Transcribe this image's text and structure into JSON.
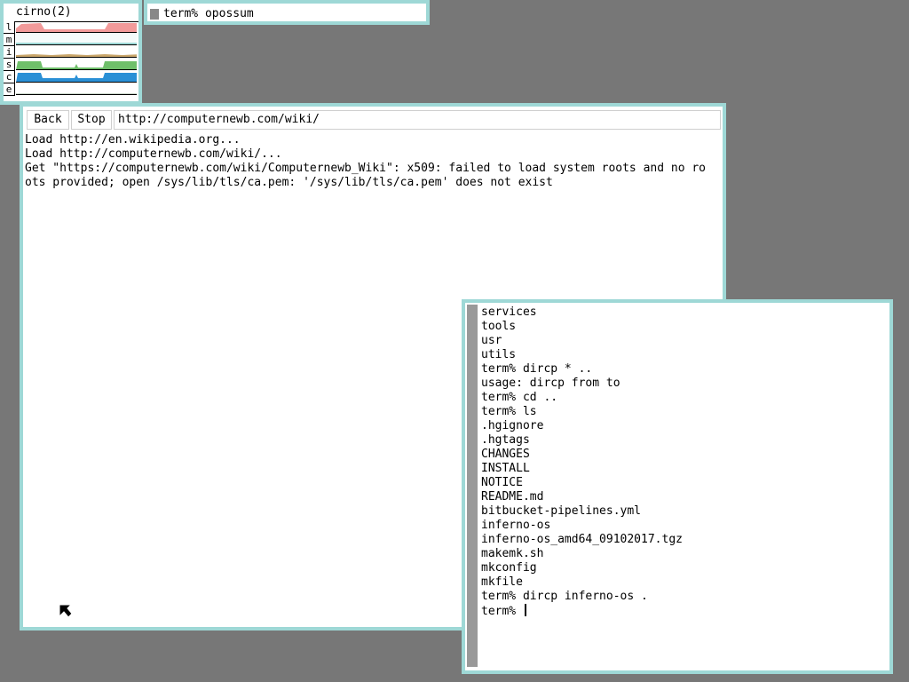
{
  "stats": {
    "title": "cirno(2)",
    "labels": [
      "l",
      "m",
      "i",
      "s",
      "c",
      "e"
    ],
    "colors": {
      "load": "#f29a9a",
      "swap": "#6fbf6a",
      "cpu": "#2a90d6",
      "ether": "#c8d4c8",
      "intr": "#c9a66b",
      "memory": "#9ed8d6"
    }
  },
  "termbar": {
    "text": "term% opossum"
  },
  "browser": {
    "back_label": "Back",
    "stop_label": "Stop",
    "url": "http://computernewb.com/wiki/",
    "lines": [
      "Load http://en.wikipedia.org...",
      "Load http://computernewb.com/wiki/...",
      "Get \"https://computernewb.com/wiki/Computernewb_Wiki\": x509: failed to load system roots and no ro",
      "ots provided; open /sys/lib/tls/ca.pem: '/sys/lib/tls/ca.pem' does not exist"
    ]
  },
  "terminal": {
    "lines": [
      "services",
      "tools",
      "usr",
      "utils",
      "term% dircp * ..",
      "usage: dircp from to",
      "term% cd ..",
      "term% ls",
      ".hgignore",
      ".hgtags",
      "CHANGES",
      "INSTALL",
      "NOTICE",
      "README.md",
      "bitbucket-pipelines.yml",
      "inferno-os",
      "inferno-os_amd64_09102017.tgz",
      "makemk.sh",
      "mkconfig",
      "mkfile",
      "term% dircp inferno-os ."
    ],
    "prompt": "term% "
  },
  "pointer": {
    "icon": "arrow-pointer-icon"
  }
}
